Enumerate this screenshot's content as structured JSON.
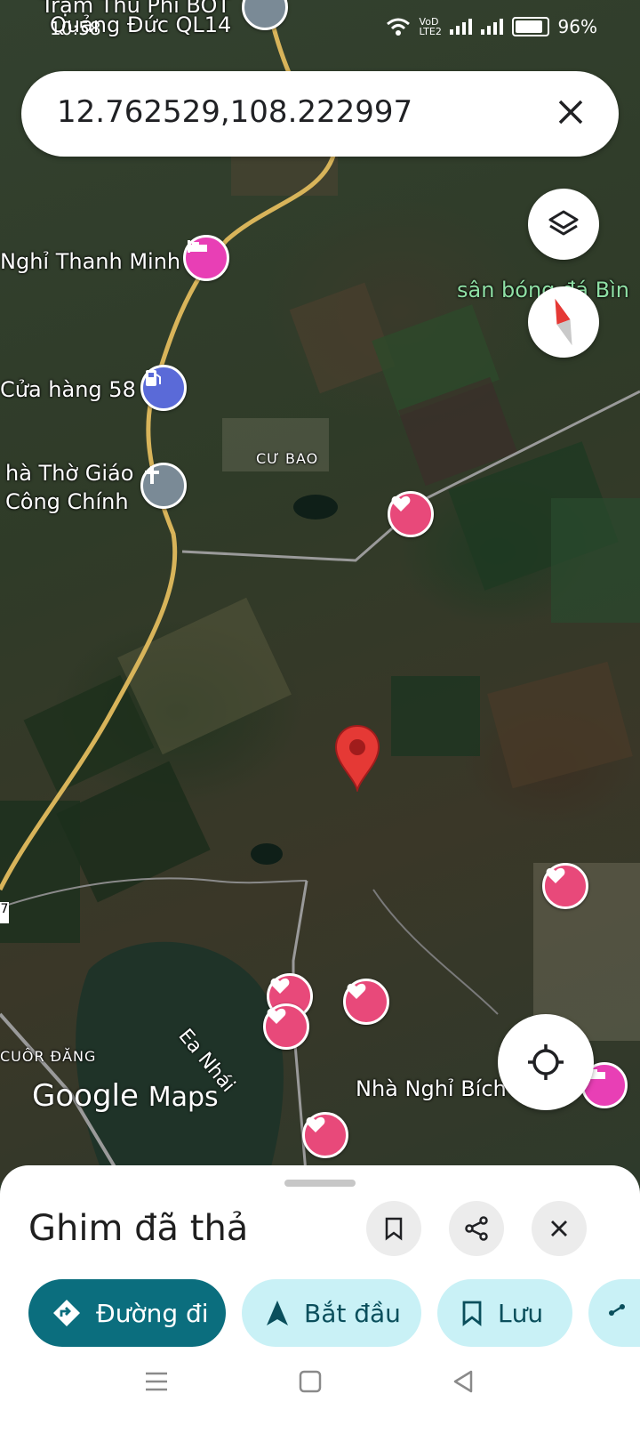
{
  "status_bar": {
    "time": "10:58",
    "network_label": "VoD LTE2",
    "battery": "96%"
  },
  "search": {
    "query": "12.762529,108.222997"
  },
  "map_labels": {
    "poi_top_1": "Trạm Thu Phí BOT",
    "poi_top_2": "Quảng Đức QL14",
    "hotel_1": "Nghỉ Thanh Minh",
    "field": "sân bóng đá Bìn",
    "store": "Cửa hàng 58",
    "church_1": "hà Thờ Giáo",
    "church_2": "Công Chính",
    "village": "CƯ BAO",
    "lake": "Ea Nhái",
    "commune": "CUÔR ĐĂNG",
    "hotel_2": "Nhà Nghỉ Bích",
    "road_marker": "7"
  },
  "attribution": {
    "google": "Google",
    "maps": "Maps"
  },
  "sheet": {
    "title": "Ghim đã thả",
    "chips": {
      "directions": "Đường đi",
      "start": "Bắt đầu",
      "save": "Lưu"
    }
  },
  "colors": {
    "primary_chip": "#0b6e7e",
    "secondary_chip": "#c9f1f6",
    "pin_red": "#e53935",
    "saved_pin": "#e8497a"
  }
}
